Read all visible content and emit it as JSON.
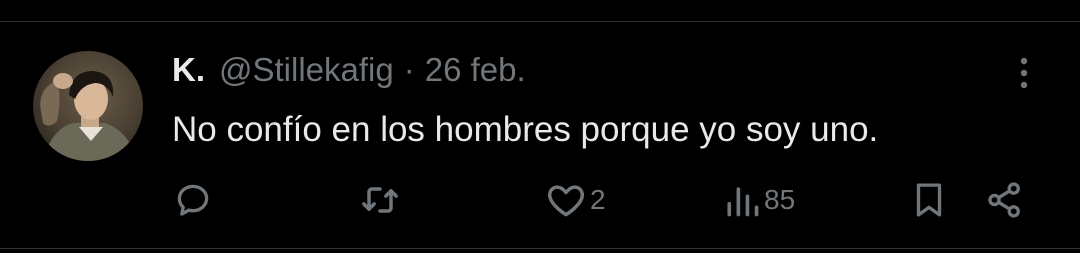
{
  "tweet": {
    "display_name": "K.",
    "handle": "@Stillekafig",
    "separator": "·",
    "date": "26 feb.",
    "text": "No confío en los hombres porque yo soy uno."
  },
  "actions": {
    "reply": {
      "icon": "reply-icon",
      "count": ""
    },
    "retweet": {
      "icon": "retweet-icon",
      "count": ""
    },
    "like": {
      "icon": "heart-icon",
      "count": "2"
    },
    "views": {
      "icon": "views-icon",
      "count": "85"
    },
    "bookmark": {
      "icon": "bookmark-icon"
    },
    "share": {
      "icon": "share-icon"
    }
  },
  "colors": {
    "background": "#000000",
    "primary_text": "#e7e9ea",
    "secondary_text": "#71767b",
    "divider": "#2f3336"
  }
}
